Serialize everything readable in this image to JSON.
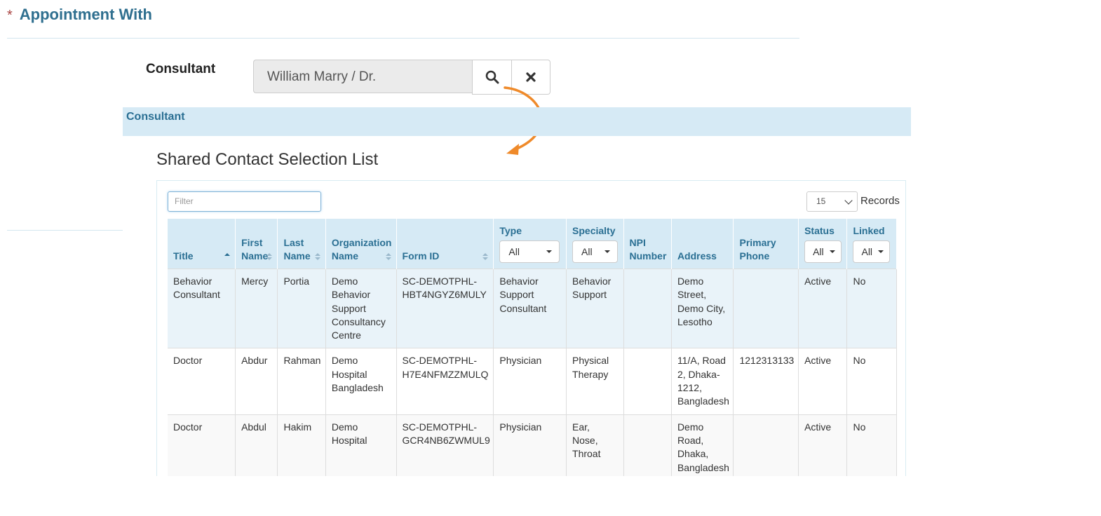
{
  "section": {
    "required_mark": "*",
    "title": "Appointment With"
  },
  "consultant_field": {
    "label": "Consultant",
    "value": "William Marry / Dr.",
    "search_icon": "search-icon",
    "clear_icon": "close-icon"
  },
  "panel": {
    "heading": "Consultant"
  },
  "list": {
    "title": "Shared Contact Selection List",
    "filter_placeholder": "Filter",
    "page_size": "15",
    "records_label": "Records",
    "columns": {
      "title": "Title",
      "first_name": "First Name",
      "last_name": "Last Name",
      "organization_name": "Organization Name",
      "form_id": "Form ID",
      "type": "Type",
      "specialty": "Specialty",
      "npi_number": "NPI Number",
      "address": "Address",
      "primary_phone": "Primary Phone",
      "status": "Status",
      "linked": "Linked"
    },
    "filters": {
      "type": "All",
      "specialty": "All",
      "status": "All",
      "linked": "All"
    },
    "rows": [
      {
        "title": "Behavior Consultant",
        "first_name": "Mercy",
        "last_name": "Portia",
        "organization_name": "Demo Behavior Support Consultancy Centre",
        "form_id": "SC-DEMOTPHL-HBT4NGYZ6MULY",
        "type": "Behavior Support Consultant",
        "specialty": "Behavior Support",
        "npi_number": "",
        "address": "Demo Street, Demo City, Lesotho",
        "primary_phone": "",
        "status": "Active",
        "linked": "No"
      },
      {
        "title": "Doctor",
        "first_name": "Abdur",
        "last_name": "Rahman",
        "organization_name": "Demo Hospital Bangladesh",
        "form_id": "SC-DEMOTPHL-H7E4NFMZZMULQ",
        "type": "Physician",
        "specialty": "Physical Therapy",
        "npi_number": "",
        "address": "11/A, Road 2, Dhaka-1212, Bangladesh",
        "primary_phone": "1212313133",
        "status": "Active",
        "linked": "No"
      },
      {
        "title": "Doctor",
        "first_name": "Abdul",
        "last_name": "Hakim",
        "organization_name": "Demo Hospital",
        "form_id": "SC-DEMOTPHL-GCR4NB6ZWMUL9",
        "type": "Physician",
        "specialty": "Ear, Nose, Throat",
        "npi_number": "",
        "address": "Demo Road, Dhaka, Bangladesh",
        "primary_phone": "",
        "status": "Active",
        "linked": "No"
      }
    ]
  },
  "colors": {
    "heading_blue": "#2f6f8f",
    "header_bg": "#d6eaf5",
    "annotation_arrow": "#ef8a2a",
    "required_red": "#a94442"
  }
}
